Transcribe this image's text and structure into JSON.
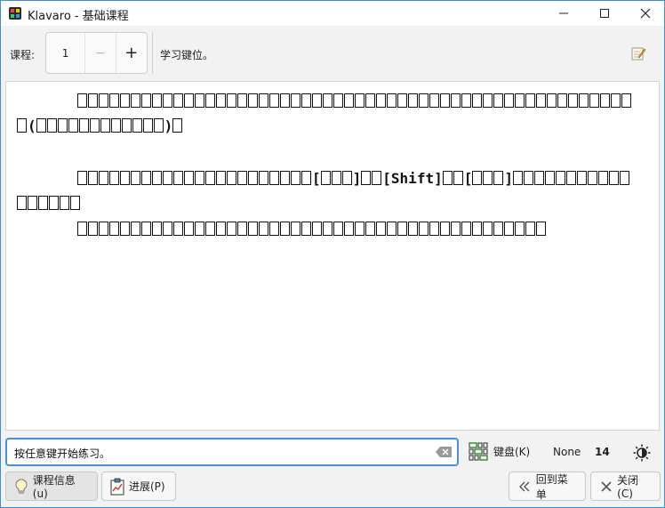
{
  "window": {
    "title": "Klavaro - 基础课程",
    "minimize_icon": "minimize-icon",
    "maximize_icon": "maximize-icon",
    "close_icon": "close-icon"
  },
  "toolbar": {
    "lesson_label": "课程:",
    "lesson_number": "1",
    "minus_symbol": "−",
    "plus_symbol": "+",
    "lesson_description": "学习键位。"
  },
  "content": {
    "paragraphs": [
      {
        "indent": true,
        "segments": [
          {
            "glyphs": 26
          },
          {
            "glyphs": 27
          },
          {
            "text": "("
          },
          {
            "glyphs": 6
          },
          {
            "glyphs": 6
          },
          {
            "text": ")"
          },
          {
            "glyphs": 1
          }
        ]
      },
      {
        "indent": true,
        "segments": [
          {
            "glyphs": 22
          },
          {
            "text": "["
          },
          {
            "glyphs": 3
          },
          {
            "text": "]"
          },
          {
            "glyphs": 2
          },
          {
            "text": "[Shift]"
          },
          {
            "glyphs": 2
          },
          {
            "text": "["
          },
          {
            "glyphs": 3
          },
          {
            "text": "]"
          },
          {
            "glyphs": 17
          }
        ]
      },
      {
        "indent": true,
        "segments": [
          {
            "glyphs": 26
          },
          {
            "glyphs": 18
          }
        ]
      }
    ],
    "shift_key_text": "[Shift]"
  },
  "input": {
    "value": "按任意键开始练习。",
    "clear_icon": "backspace-clear-icon"
  },
  "status": {
    "keyboard_label": "键盘(K)",
    "keyboard_icon": "keyboard-grid-icon",
    "layout_name": "None",
    "count": "14",
    "theme_icon": "contrast-sun-icon"
  },
  "buttons": {
    "lesson_info": "课程信息(u)",
    "progress": "进展(P)",
    "back_to_menu": "回到菜单",
    "close": "关闭(C)"
  },
  "colors": {
    "accent": "#4a90d9",
    "window_border": "#3b8fd6"
  }
}
